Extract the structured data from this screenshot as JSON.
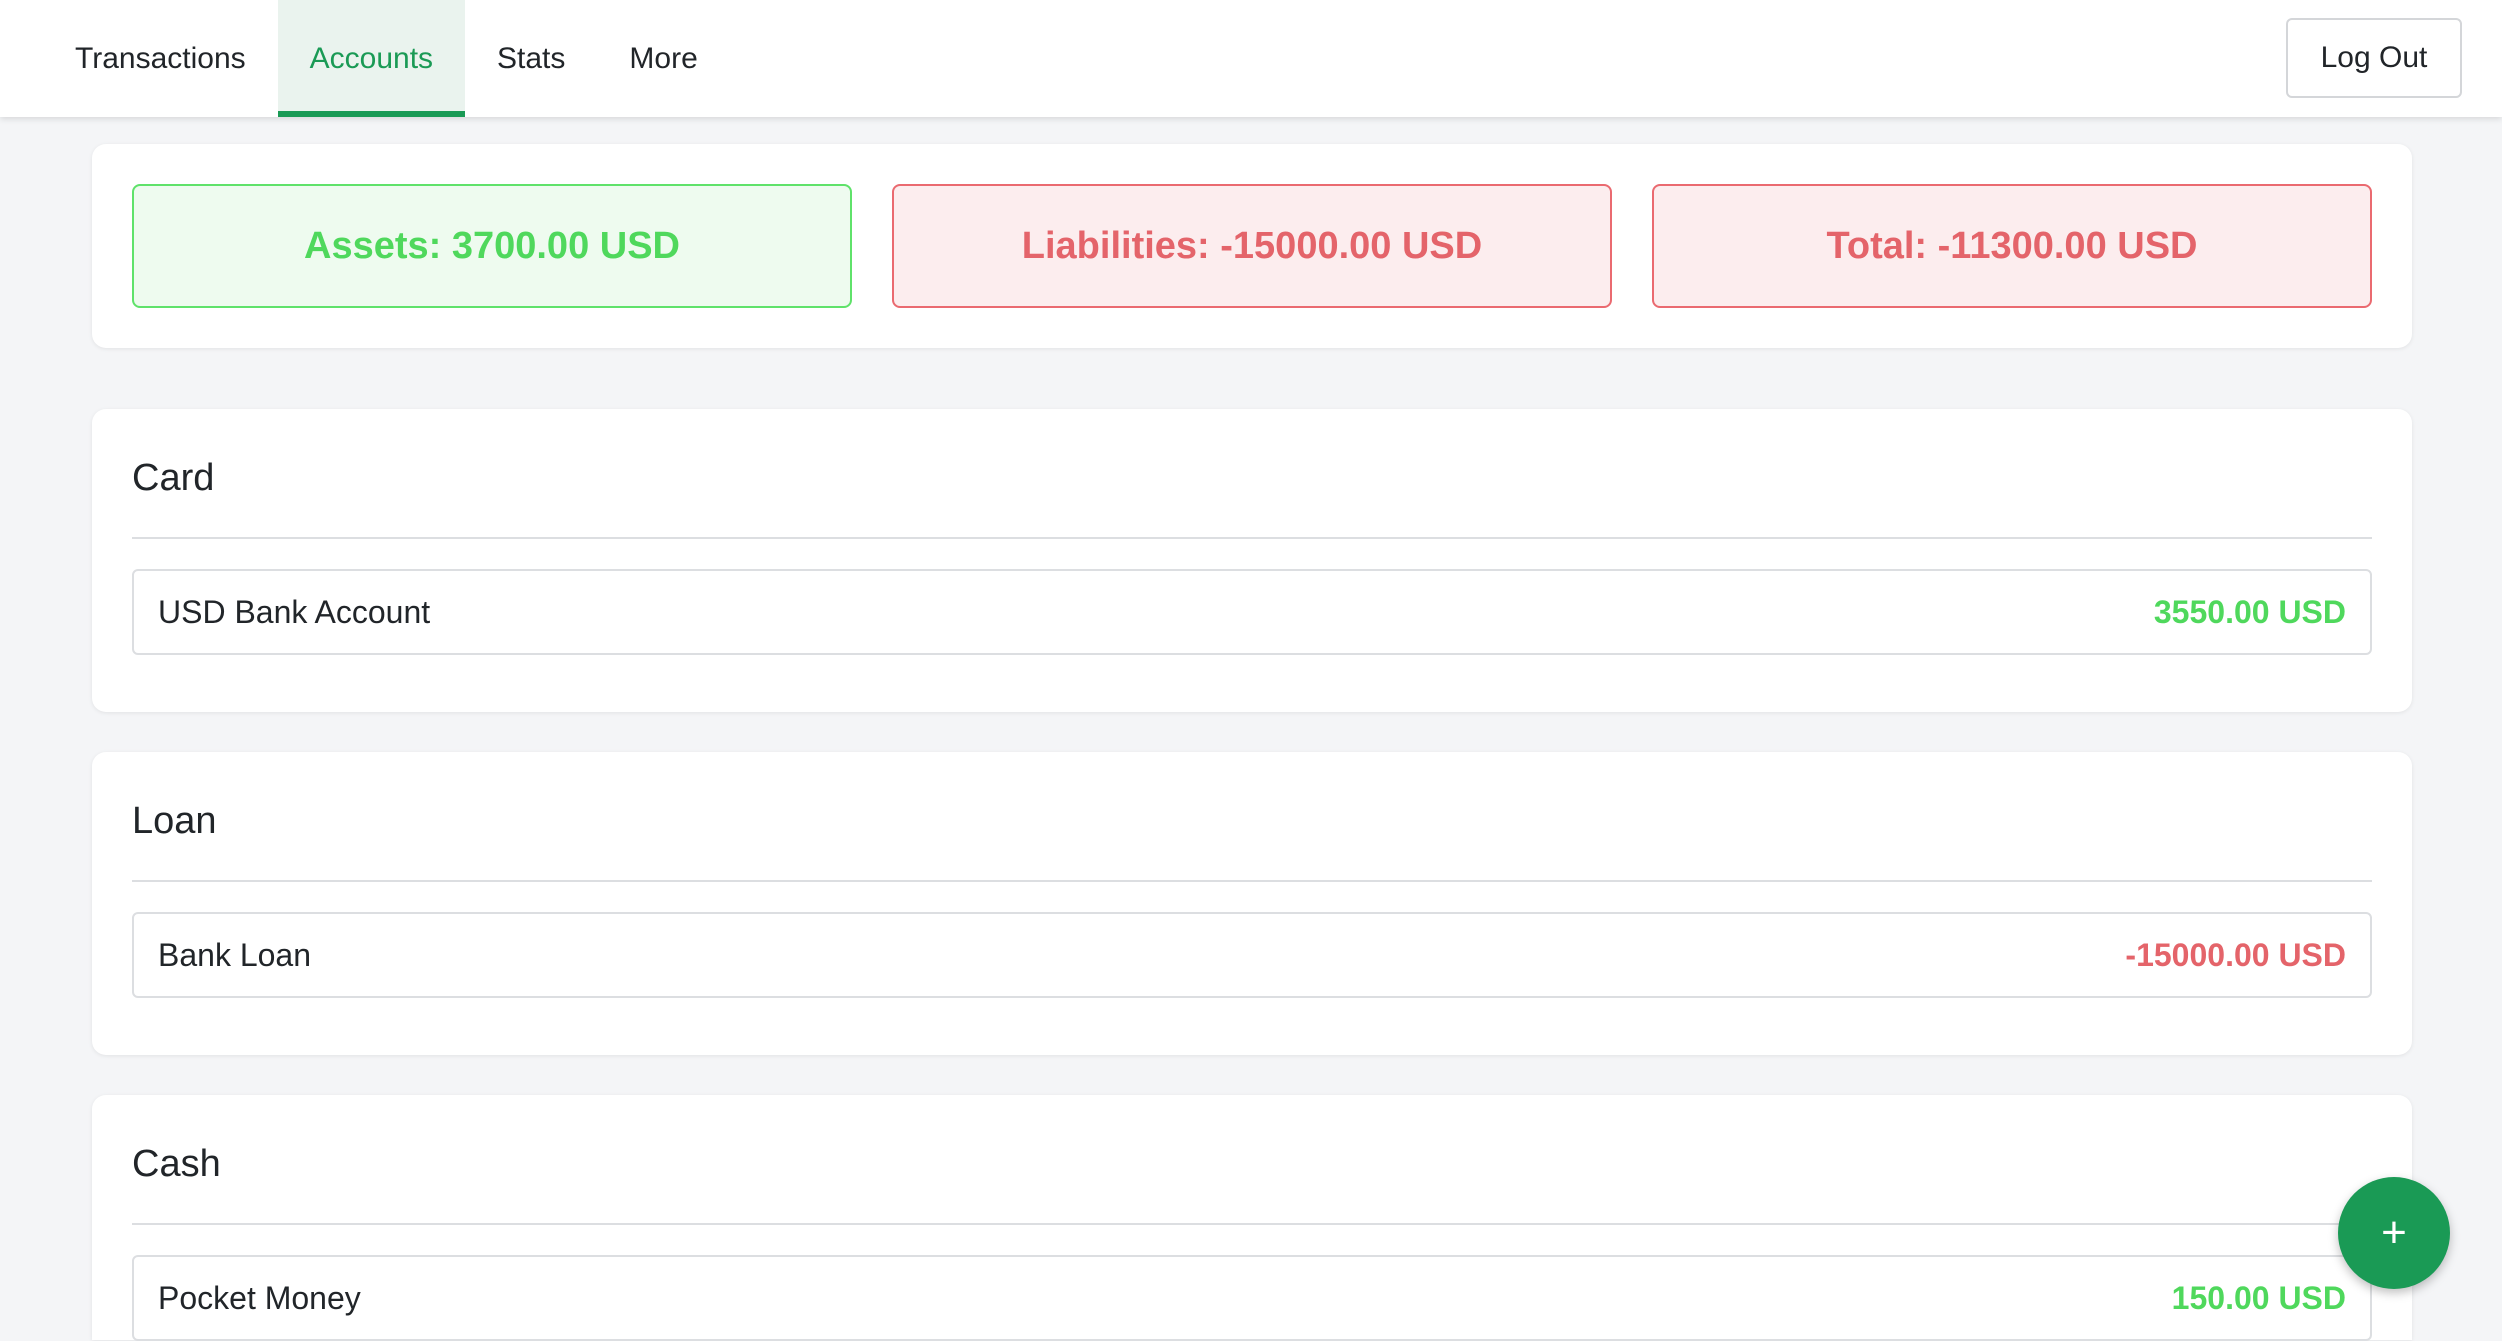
{
  "nav": {
    "tabs": [
      {
        "label": "Transactions",
        "active": false
      },
      {
        "label": "Accounts",
        "active": true
      },
      {
        "label": "Stats",
        "active": false
      },
      {
        "label": "More",
        "active": false
      }
    ],
    "logout_label": "Log Out"
  },
  "summary": {
    "assets": "Assets: 3700.00 USD",
    "liabilities": "Liabilities: -15000.00 USD",
    "total": "Total: -11300.00 USD"
  },
  "groups": [
    {
      "title": "Card",
      "accounts": [
        {
          "name": "USD Bank Account",
          "balance": "3550.00 USD"
        }
      ]
    },
    {
      "title": "Loan",
      "accounts": [
        {
          "name": "Bank Loan",
          "balance": "-15000.00 USD"
        }
      ]
    },
    {
      "title": "Cash",
      "accounts": [
        {
          "name": "Pocket Money",
          "balance": "150.00 USD"
        }
      ]
    }
  ],
  "fab": {
    "icon": "plus-icon",
    "label": "+"
  },
  "colors": {
    "accent": "#1a9a55",
    "positive": "#4fd85c",
    "negative": "#e4646a"
  }
}
